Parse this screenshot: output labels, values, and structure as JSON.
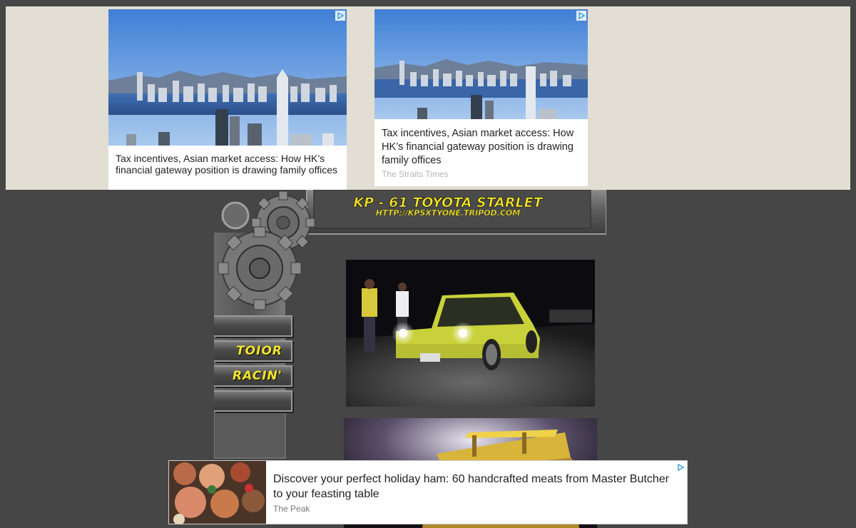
{
  "ads": {
    "top_left": {
      "headline": "Tax incentives, Asian market access: How HK’s financial gateway position is drawing family offices",
      "source": ""
    },
    "top_right": {
      "headline": "Tax incentives, Asian market access: How HK’s financial gateway position is drawing family offices",
      "source": "The Straits Times"
    },
    "bottom": {
      "headline": "Discover your perfect holiday ham: 60 handcrafted meats from Master Butcher to your feasting table",
      "source": "The Peak"
    }
  },
  "site": {
    "title": "KP - 61 TOYOTA STARLET",
    "url": "HTTP://KPSXTYONE.TRIPOD.COM",
    "nav": [
      "",
      "TOIOR",
      "RACIN'",
      ""
    ]
  },
  "colors": {
    "page_bg": "#464646",
    "banner_bg": "#e2ded3",
    "title_yellow": "#f4e52a",
    "adchoice_blue": "#3aa7d8"
  }
}
